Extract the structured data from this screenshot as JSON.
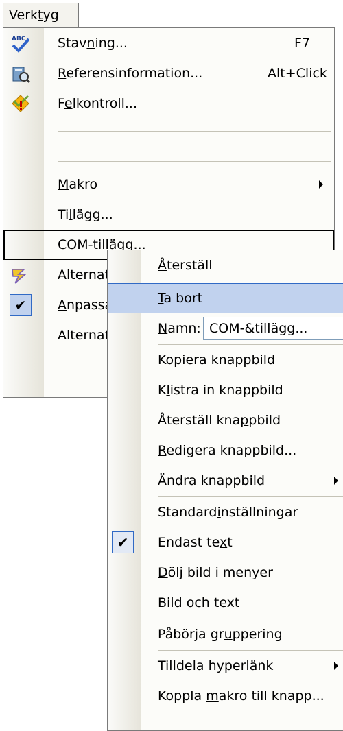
{
  "menu_title": {
    "pre": "Verk",
    "u": "t",
    "post": "yg"
  },
  "menu": {
    "items": [
      {
        "pre": "Stav",
        "u": "n",
        "post": "ing...",
        "shortcut": "F7",
        "icon": "spelling-abc-check-icon"
      },
      {
        "pre": "",
        "u": "R",
        "post": "eferensinformation...",
        "shortcut": "Alt+Click",
        "icon": "research-book-icon"
      },
      {
        "pre": "F",
        "u": "e",
        "post": "lkontroll...",
        "icon": "error-check-diamond-icon"
      },
      {
        "pre": "",
        "u": "M",
        "post": "akro"
      },
      {
        "pre": "Ti",
        "u": "l",
        "post": "lägg..."
      },
      {
        "pre": "COM-",
        "u": "t",
        "post": "illägg..."
      },
      {
        "pre": "Alternat",
        "u": "",
        "post": ""
      },
      {
        "pre": "",
        "u": "A",
        "post": "npassa"
      },
      {
        "pre": "Alternat",
        "u": "",
        "post": ""
      }
    ],
    "check_glyph": "✔"
  },
  "submenu": {
    "items": [
      {
        "pre": "",
        "u": "Å",
        "post": "terställ"
      },
      {
        "pre": "",
        "u": "T",
        "post": "a bort"
      },
      {
        "pre": "",
        "u": "N",
        "post": "amn:"
      },
      {
        "pre": "K",
        "u": "o",
        "post": "piera knappbild"
      },
      {
        "pre": "K",
        "u": "l",
        "post": "istra in knappbild"
      },
      {
        "pre": "Återställ kna",
        "u": "p",
        "post": "pbild"
      },
      {
        "pre": "",
        "u": "R",
        "post": "edigera knappbild..."
      },
      {
        "pre": "Ändra ",
        "u": "k",
        "post": "nappbild"
      },
      {
        "pre": "Standard",
        "u": "i",
        "post": "nställningar"
      },
      {
        "pre": "Endast te",
        "u": "x",
        "post": "t"
      },
      {
        "pre": "",
        "u": "D",
        "post": "ölj bild i menyer"
      },
      {
        "pre": "Bild o",
        "u": "c",
        "post": "h text"
      },
      {
        "pre": "Påbörja gr",
        "u": "u",
        "post": "ppering"
      },
      {
        "pre": "Tilldela ",
        "u": "h",
        "post": "yperlänk"
      },
      {
        "pre": "Koppla ",
        "u": "m",
        "post": "akro till knapp..."
      }
    ],
    "name_value": "COM-&tillägg...",
    "check_glyph": "✔"
  }
}
